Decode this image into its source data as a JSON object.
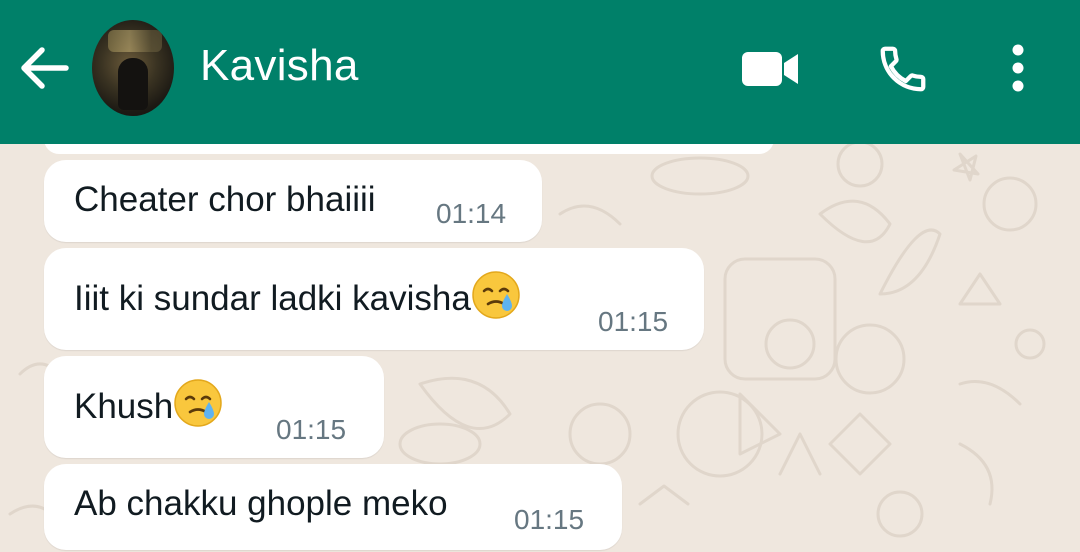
{
  "header": {
    "contact_name": "Kavisha",
    "colors": {
      "bar": "#008069",
      "icon": "#ffffff"
    },
    "icons": {
      "back": "arrow-left-icon",
      "avatar": "avatar",
      "video": "video-camera-icon",
      "call": "phone-icon",
      "menu": "more-vertical-icon"
    }
  },
  "chat": {
    "colors": {
      "wallpaper": "#efe7de",
      "bubble": "#ffffff",
      "time": "#667781"
    },
    "messages": [
      {
        "text": "Cheater chor bhaiiii",
        "time": "01:14"
      },
      {
        "text": "Iiit ki sundar ladki kavisha",
        "emoji": "crying-face-emoji",
        "time": "01:15"
      },
      {
        "text": "Khush",
        "emoji": "crying-face-emoji",
        "time": "01:15"
      },
      {
        "text": "Ab chakku ghople meko",
        "time": "01:15"
      }
    ]
  }
}
